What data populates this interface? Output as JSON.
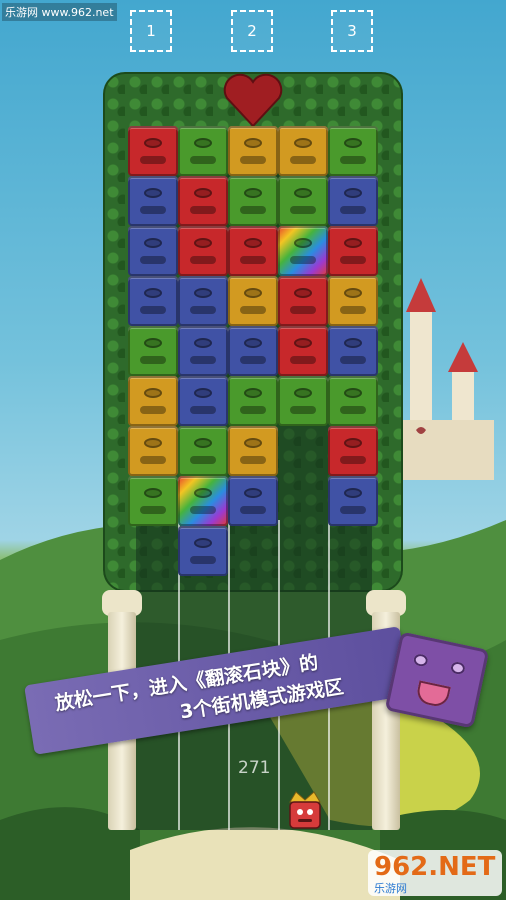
{
  "watermark": {
    "site": "乐游网 www.962.net"
  },
  "levels": [
    "1",
    "2",
    "3"
  ],
  "board": {
    "rows": [
      [
        "red",
        "green",
        "yellow",
        "yellow",
        "green"
      ],
      [
        "blue",
        "red",
        "green",
        "green",
        "blue"
      ],
      [
        "blue",
        "red",
        "red",
        "rainbow",
        "red"
      ],
      [
        "blue",
        "blue",
        "yellow",
        "red",
        "yellow"
      ],
      [
        "green",
        "blue",
        "blue",
        "red",
        "blue"
      ],
      [
        "yellow",
        "blue",
        "green",
        "green",
        "green"
      ],
      [
        "yellow",
        "green",
        "yellow",
        "empty",
        "red"
      ],
      [
        "green",
        "rainbow",
        "blue",
        "empty",
        "blue"
      ],
      [
        "empty",
        "blue",
        "empty",
        "empty",
        "empty"
      ]
    ]
  },
  "colors": {
    "red": "#c7282b",
    "green": "#4a9a2c",
    "yellow": "#d29a21",
    "blue": "#4052a5",
    "banner": "#6c5eaa",
    "hedge": "#2e6a2b"
  },
  "banner": {
    "line1": "放松一下，进入《翻滚石块》的",
    "line2": "3个街机模式游戏区"
  },
  "score": "271",
  "logo": {
    "main": "962.NET",
    "sub": "乐游网"
  },
  "icons": [
    "heart-rose-icon",
    "king-icon",
    "purple-cube-icon",
    "castle-icon"
  ]
}
